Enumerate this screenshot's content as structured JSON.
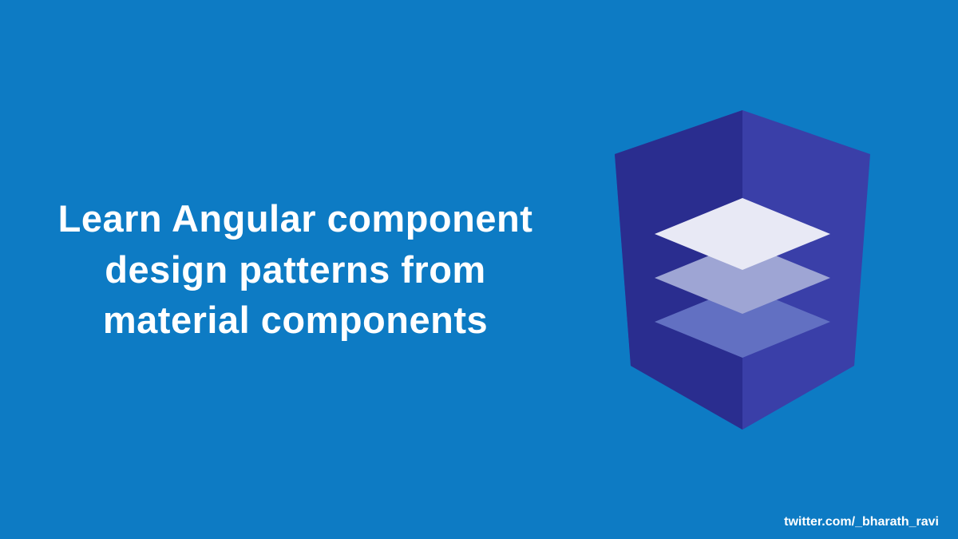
{
  "title": "Learn Angular component design patterns from material components",
  "attribution": "twitter.com/_bharath_ravi",
  "colors": {
    "background": "#0d7bc4",
    "shield_left": "#2a2d8f",
    "shield_right": "#3a3fa8",
    "layer_top": "#e8e9f5",
    "layer_mid": "#9ea5d4",
    "layer_bottom": "#6270c2"
  }
}
